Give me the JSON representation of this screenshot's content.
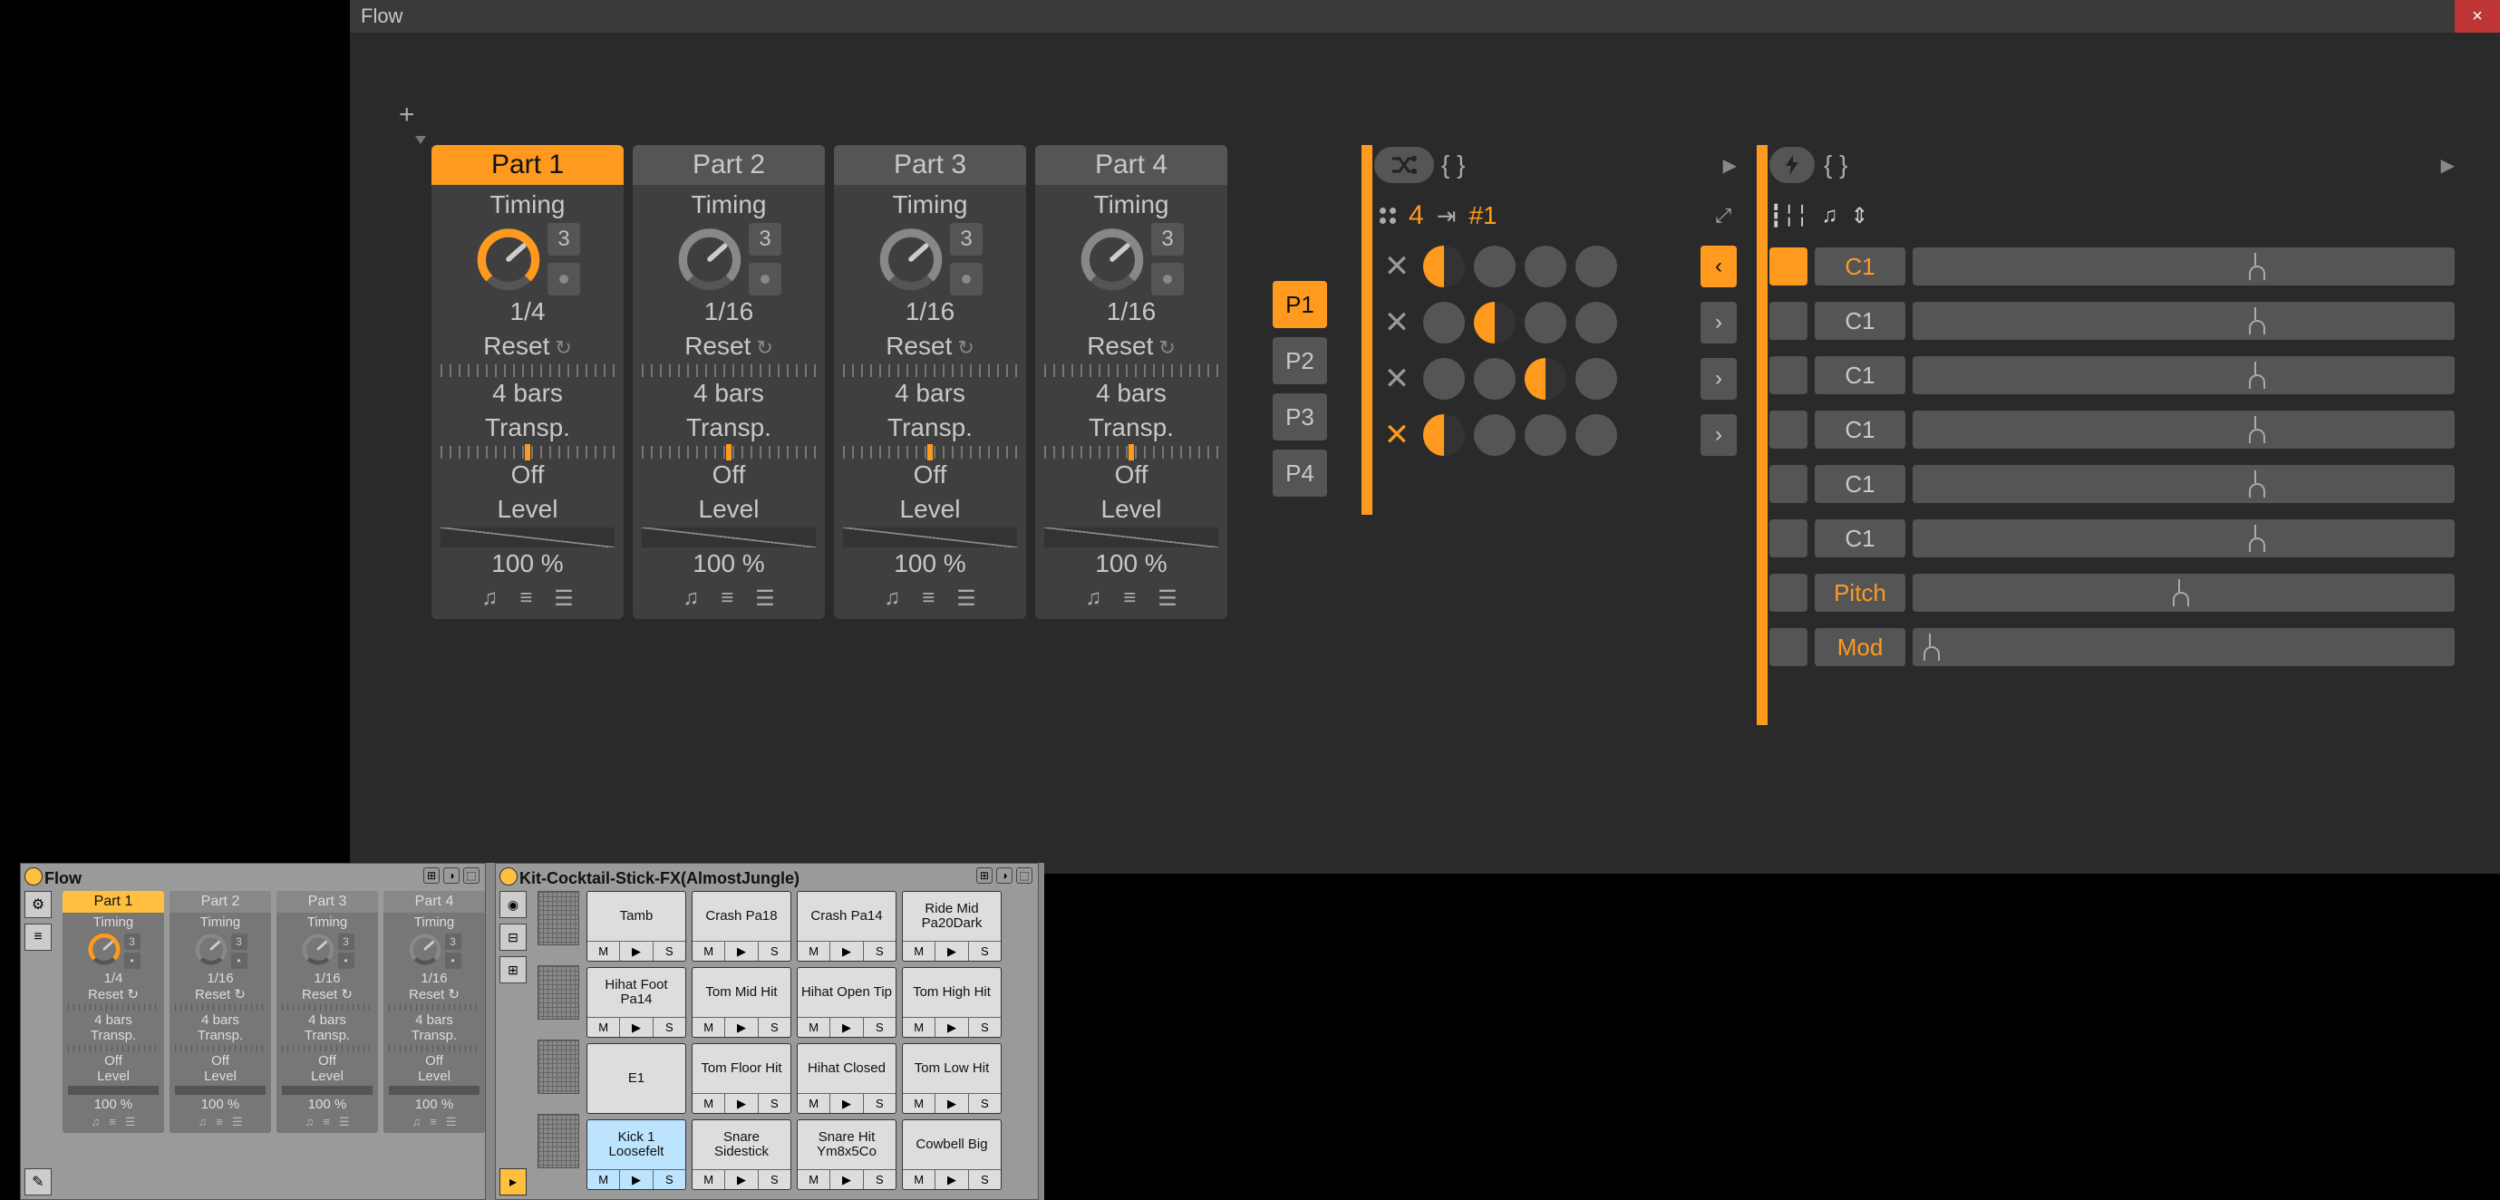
{
  "window": {
    "title": "Flow",
    "close": "×"
  },
  "parts": [
    {
      "name": "Part 1",
      "active": true,
      "timing_label": "Timing",
      "knob_num": "3",
      "timing_value": "1/4",
      "reset": "Reset",
      "bars": "4 bars",
      "transp_label": "Transp.",
      "transp_value": "Off",
      "level_label": "Level",
      "level_value": "100 %"
    },
    {
      "name": "Part 2",
      "active": false,
      "timing_label": "Timing",
      "knob_num": "3",
      "timing_value": "1/16",
      "reset": "Reset",
      "bars": "4 bars",
      "transp_label": "Transp.",
      "transp_value": "Off",
      "level_label": "Level",
      "level_value": "100 %"
    },
    {
      "name": "Part 3",
      "active": false,
      "timing_label": "Timing",
      "knob_num": "3",
      "timing_value": "1/16",
      "reset": "Reset",
      "bars": "4 bars",
      "transp_label": "Transp.",
      "transp_value": "Off",
      "level_label": "Level",
      "level_value": "100 %"
    },
    {
      "name": "Part 4",
      "active": false,
      "timing_label": "Timing",
      "knob_num": "3",
      "timing_value": "1/16",
      "reset": "Reset",
      "bars": "4 bars",
      "transp_label": "Transp.",
      "transp_value": "Off",
      "level_label": "Level",
      "level_value": "100 %"
    }
  ],
  "ptabs": [
    {
      "label": "P1",
      "active": true
    },
    {
      "label": "P2",
      "active": false
    },
    {
      "label": "P3",
      "active": false
    },
    {
      "label": "P4",
      "active": false
    }
  ],
  "seq": {
    "steps": "4",
    "preset": "#1",
    "rows": [
      {
        "x_active": false,
        "half_index": 0,
        "nav": "<",
        "nav_active": true
      },
      {
        "x_active": false,
        "half_index": 1,
        "nav": ">",
        "nav_active": false
      },
      {
        "x_active": false,
        "half_index": 2,
        "nav": ">",
        "nav_active": false
      },
      {
        "x_active": true,
        "half_index": 0,
        "nav": ">",
        "nav_active": false
      }
    ]
  },
  "notes": {
    "rows": [
      {
        "label": "C1",
        "active": true,
        "handle_pos": 0.62
      },
      {
        "label": "C1",
        "active": false,
        "handle_pos": 0.62
      },
      {
        "label": "C1",
        "active": false,
        "handle_pos": 0.62
      },
      {
        "label": "C1",
        "active": false,
        "handle_pos": 0.62
      },
      {
        "label": "C1",
        "active": false,
        "handle_pos": 0.62
      },
      {
        "label": "C1",
        "active": false,
        "handle_pos": 0.62
      },
      {
        "label": "Pitch",
        "active": false,
        "handle_pos": 0.48,
        "label_active": true
      },
      {
        "label": "Mod",
        "active": false,
        "handle_pos": 0.02,
        "label_active": true
      }
    ]
  },
  "rack": {
    "dev1": {
      "title": "Flow"
    },
    "dev2": {
      "title": "Kit-Cocktail-Stick-FX(AlmostJungle)"
    },
    "mini_parts": [
      {
        "name": "Part 1",
        "active": true,
        "val": "1/4"
      },
      {
        "name": "Part 2",
        "active": false,
        "val": "1/16"
      },
      {
        "name": "Part 3",
        "active": false,
        "val": "1/16"
      },
      {
        "name": "Part 4",
        "active": false,
        "val": "1/16"
      }
    ],
    "mini_common": {
      "timing": "Timing",
      "num": "3",
      "reset": "Reset ↻",
      "bars": "4 bars",
      "transp": "Transp.",
      "off": "Off",
      "level": "Level",
      "pct": "100 %"
    },
    "pads": [
      [
        "Tamb",
        "Crash Pa18",
        "Crash Pa14",
        "Ride Mid Pa20Dark"
      ],
      [
        "Hihat Foot Pa14",
        "Tom Mid Hit",
        "Hihat Open Tip",
        "Tom High Hit"
      ],
      [
        "E1",
        "Tom Floor Hit",
        "Hihat Closed",
        "Tom Low Hit"
      ],
      [
        "Kick 1 Loosefelt",
        "Snare Sidestick",
        "Snare Hit Ym8x5Co",
        "Cowbell Big"
      ]
    ],
    "pad_selected": [
      3,
      0
    ],
    "pad_btns": {
      "m": "M",
      "p": "▶",
      "s": "S"
    }
  }
}
